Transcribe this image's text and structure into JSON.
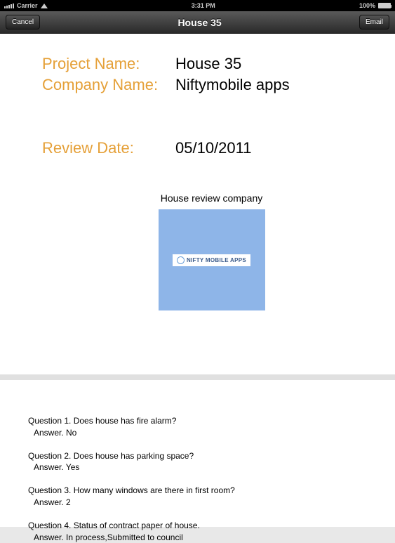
{
  "statusBar": {
    "carrier": "Carrier",
    "time": "3:31 PM",
    "battery": "100%"
  },
  "navBar": {
    "cancel": "Cancel",
    "title": "House 35",
    "email": "Email"
  },
  "fields": {
    "projectLabel": "Project Name:",
    "projectValue": "House 35",
    "companyLabel": "Company Name:",
    "companyValue": "Niftymobile apps",
    "reviewDateLabel": "Review Date:",
    "reviewDateValue": "05/10/2011"
  },
  "logo": {
    "title": "House review company",
    "text": "NIFTY MOBILE APPS"
  },
  "qa": [
    {
      "question": "Question 1. Does house has fire alarm?",
      "answer": "Answer. No"
    },
    {
      "question": "Question 2. Does house has parking space?",
      "answer": "Answer. Yes"
    },
    {
      "question": "Question 3. How many windows are there in first room?",
      "answer": "Answer. 2"
    },
    {
      "question": "Question 4. Status of contract paper of house.",
      "answer": "Answer.  In process,Submitted to council"
    }
  ]
}
